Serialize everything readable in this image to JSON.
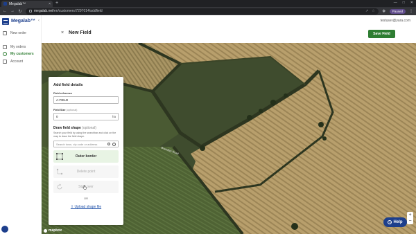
{
  "browser": {
    "tab_title": "Megalab™",
    "tab_close": "×",
    "new_tab": "+",
    "url_host": "megalab.net",
    "url_path": "/en/customers/7297014/addfield",
    "profile_label": "Paused"
  },
  "sidebar": {
    "brand": "Megalab™",
    "collapse": "‹",
    "items": [
      {
        "label": "New order",
        "icon": "plus-square-icon"
      },
      {
        "label": "My orders",
        "icon": "list-icon"
      },
      {
        "label": "My customers",
        "icon": "users-icon",
        "active": true
      },
      {
        "label": "Account",
        "icon": "person-icon"
      }
    ]
  },
  "header": {
    "close": "×",
    "title": "New Field",
    "user_email": "testuser@yara.com",
    "save_label": "Save Field"
  },
  "panel": {
    "title": "Add field details",
    "field_reference_label": "Field reference",
    "field_reference_value": "A-FIELD",
    "field_size_label": "Field Size",
    "field_size_optional": "(optional)",
    "field_size_value": "0",
    "field_size_unit": "ha",
    "draw_title": "Draw field shape",
    "draw_optional": "(optional)",
    "draw_hint": "Search your field by using the searchbar and click on the map to draw the field shape.",
    "search_placeholder": "Search town, zip code or address",
    "tools": [
      {
        "label": "Outer border",
        "state": "active",
        "icon": "square-corners-icon"
      },
      {
        "label": "Delete point",
        "state": "disabled",
        "icon": "delete-point-icon"
      },
      {
        "label": "Start over",
        "state": "disabled",
        "icon": "refresh-icon"
      }
    ],
    "or_label": "OR",
    "upload_label": "Upload shape file"
  },
  "map": {
    "attribution": "mapbox",
    "road_label": "Brandish Road",
    "zoom_in": "+",
    "zoom_out": "−",
    "help_label": "Help",
    "help_icon": "?"
  },
  "colors": {
    "brand_blue": "#1d3f8c",
    "accent_green": "#2e7d32",
    "field_tan": "#b49b6a",
    "hedge_dark": "#2d3620"
  }
}
